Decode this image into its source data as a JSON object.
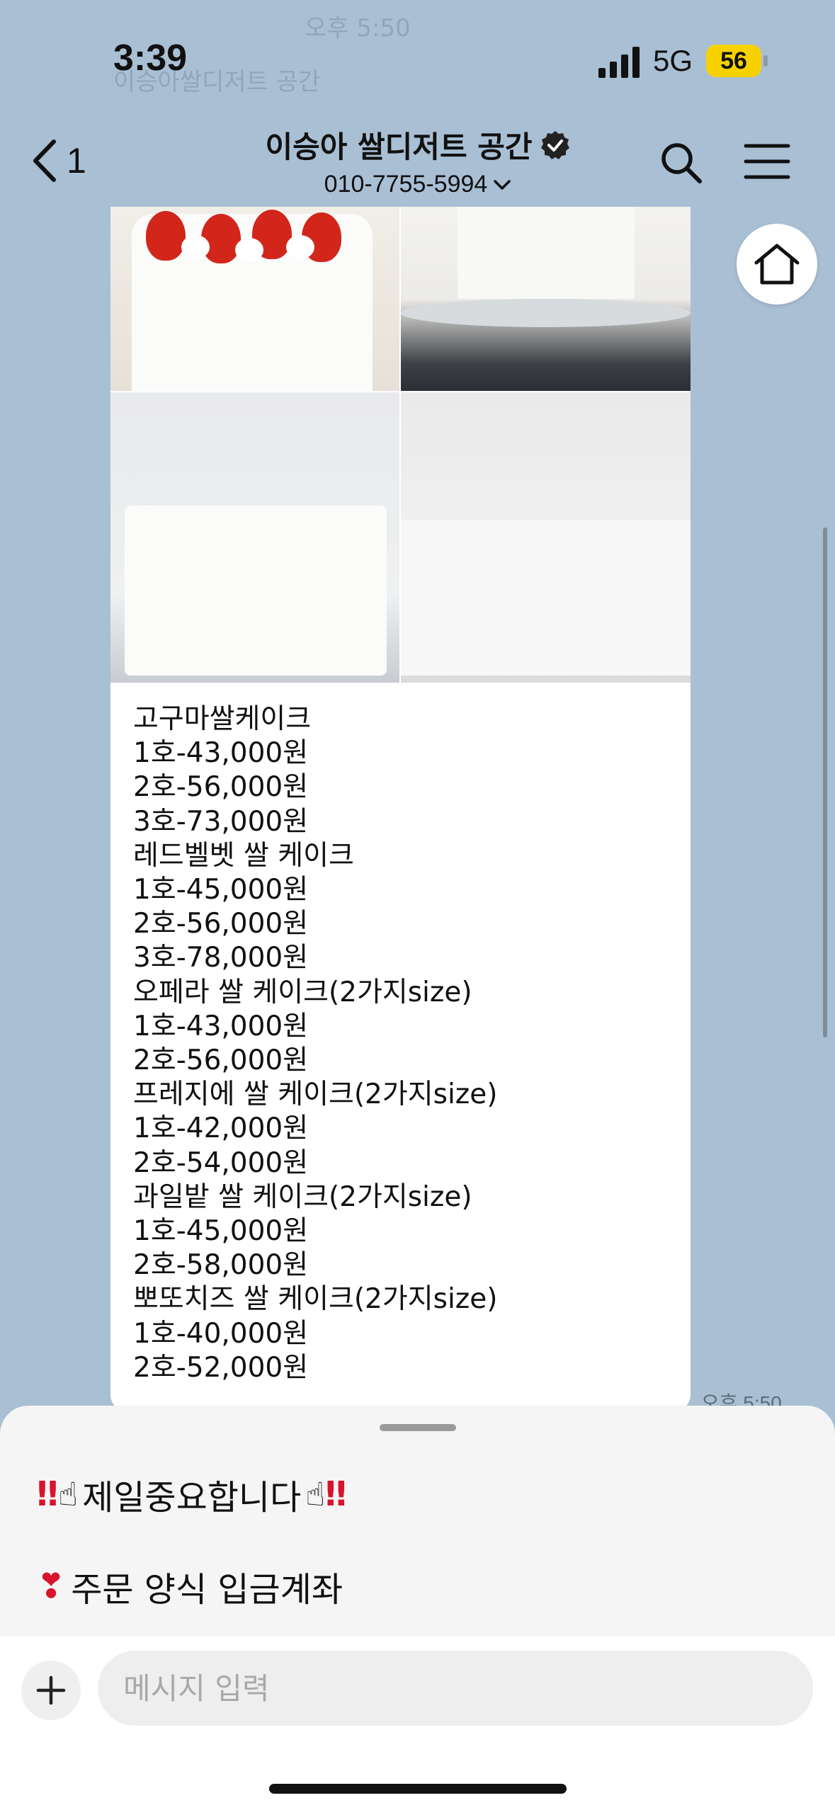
{
  "status": {
    "time": "3:39",
    "network": "5G",
    "battery": "56"
  },
  "header": {
    "back_count": "1",
    "title": "이승아 쌀디저트 공간",
    "phone": "010-7755-5994"
  },
  "background_ghost": {
    "time_label": "오후 5:50",
    "sender_name": "이승아쌀디저트 공간"
  },
  "message": {
    "lines": [
      "고구마쌀케이크",
      "1호-43,000원",
      "2호-56,000원",
      "3호-73,000원",
      "레드벨벳 쌀 케이크",
      "1호-45,000원",
      "2호-56,000원",
      "3호-78,000원",
      "오페라 쌀 케이크(2가지size)",
      "1호-43,000원",
      "2호-56,000원",
      "프레지에 쌀 케이크(2가지size)",
      "1호-42,000원",
      "2호-54,000원",
      "과일밭 쌀 케이크(2가지size)",
      "1호-45,000원",
      "2호-58,000원",
      "뽀또치즈 쌀 케이크(2가지size)",
      "1호-40,000원",
      "2호-52,000원"
    ],
    "timestamp": "오후 5:50"
  },
  "sheet": {
    "notice_1": "제일중요합니다",
    "notice_2": "주문 양식 입금계좌"
  },
  "input": {
    "placeholder": "메시지 입력"
  },
  "colors": {
    "background": "#a9bfd4",
    "accent": "#d8132c",
    "battery": "#f7d200"
  }
}
